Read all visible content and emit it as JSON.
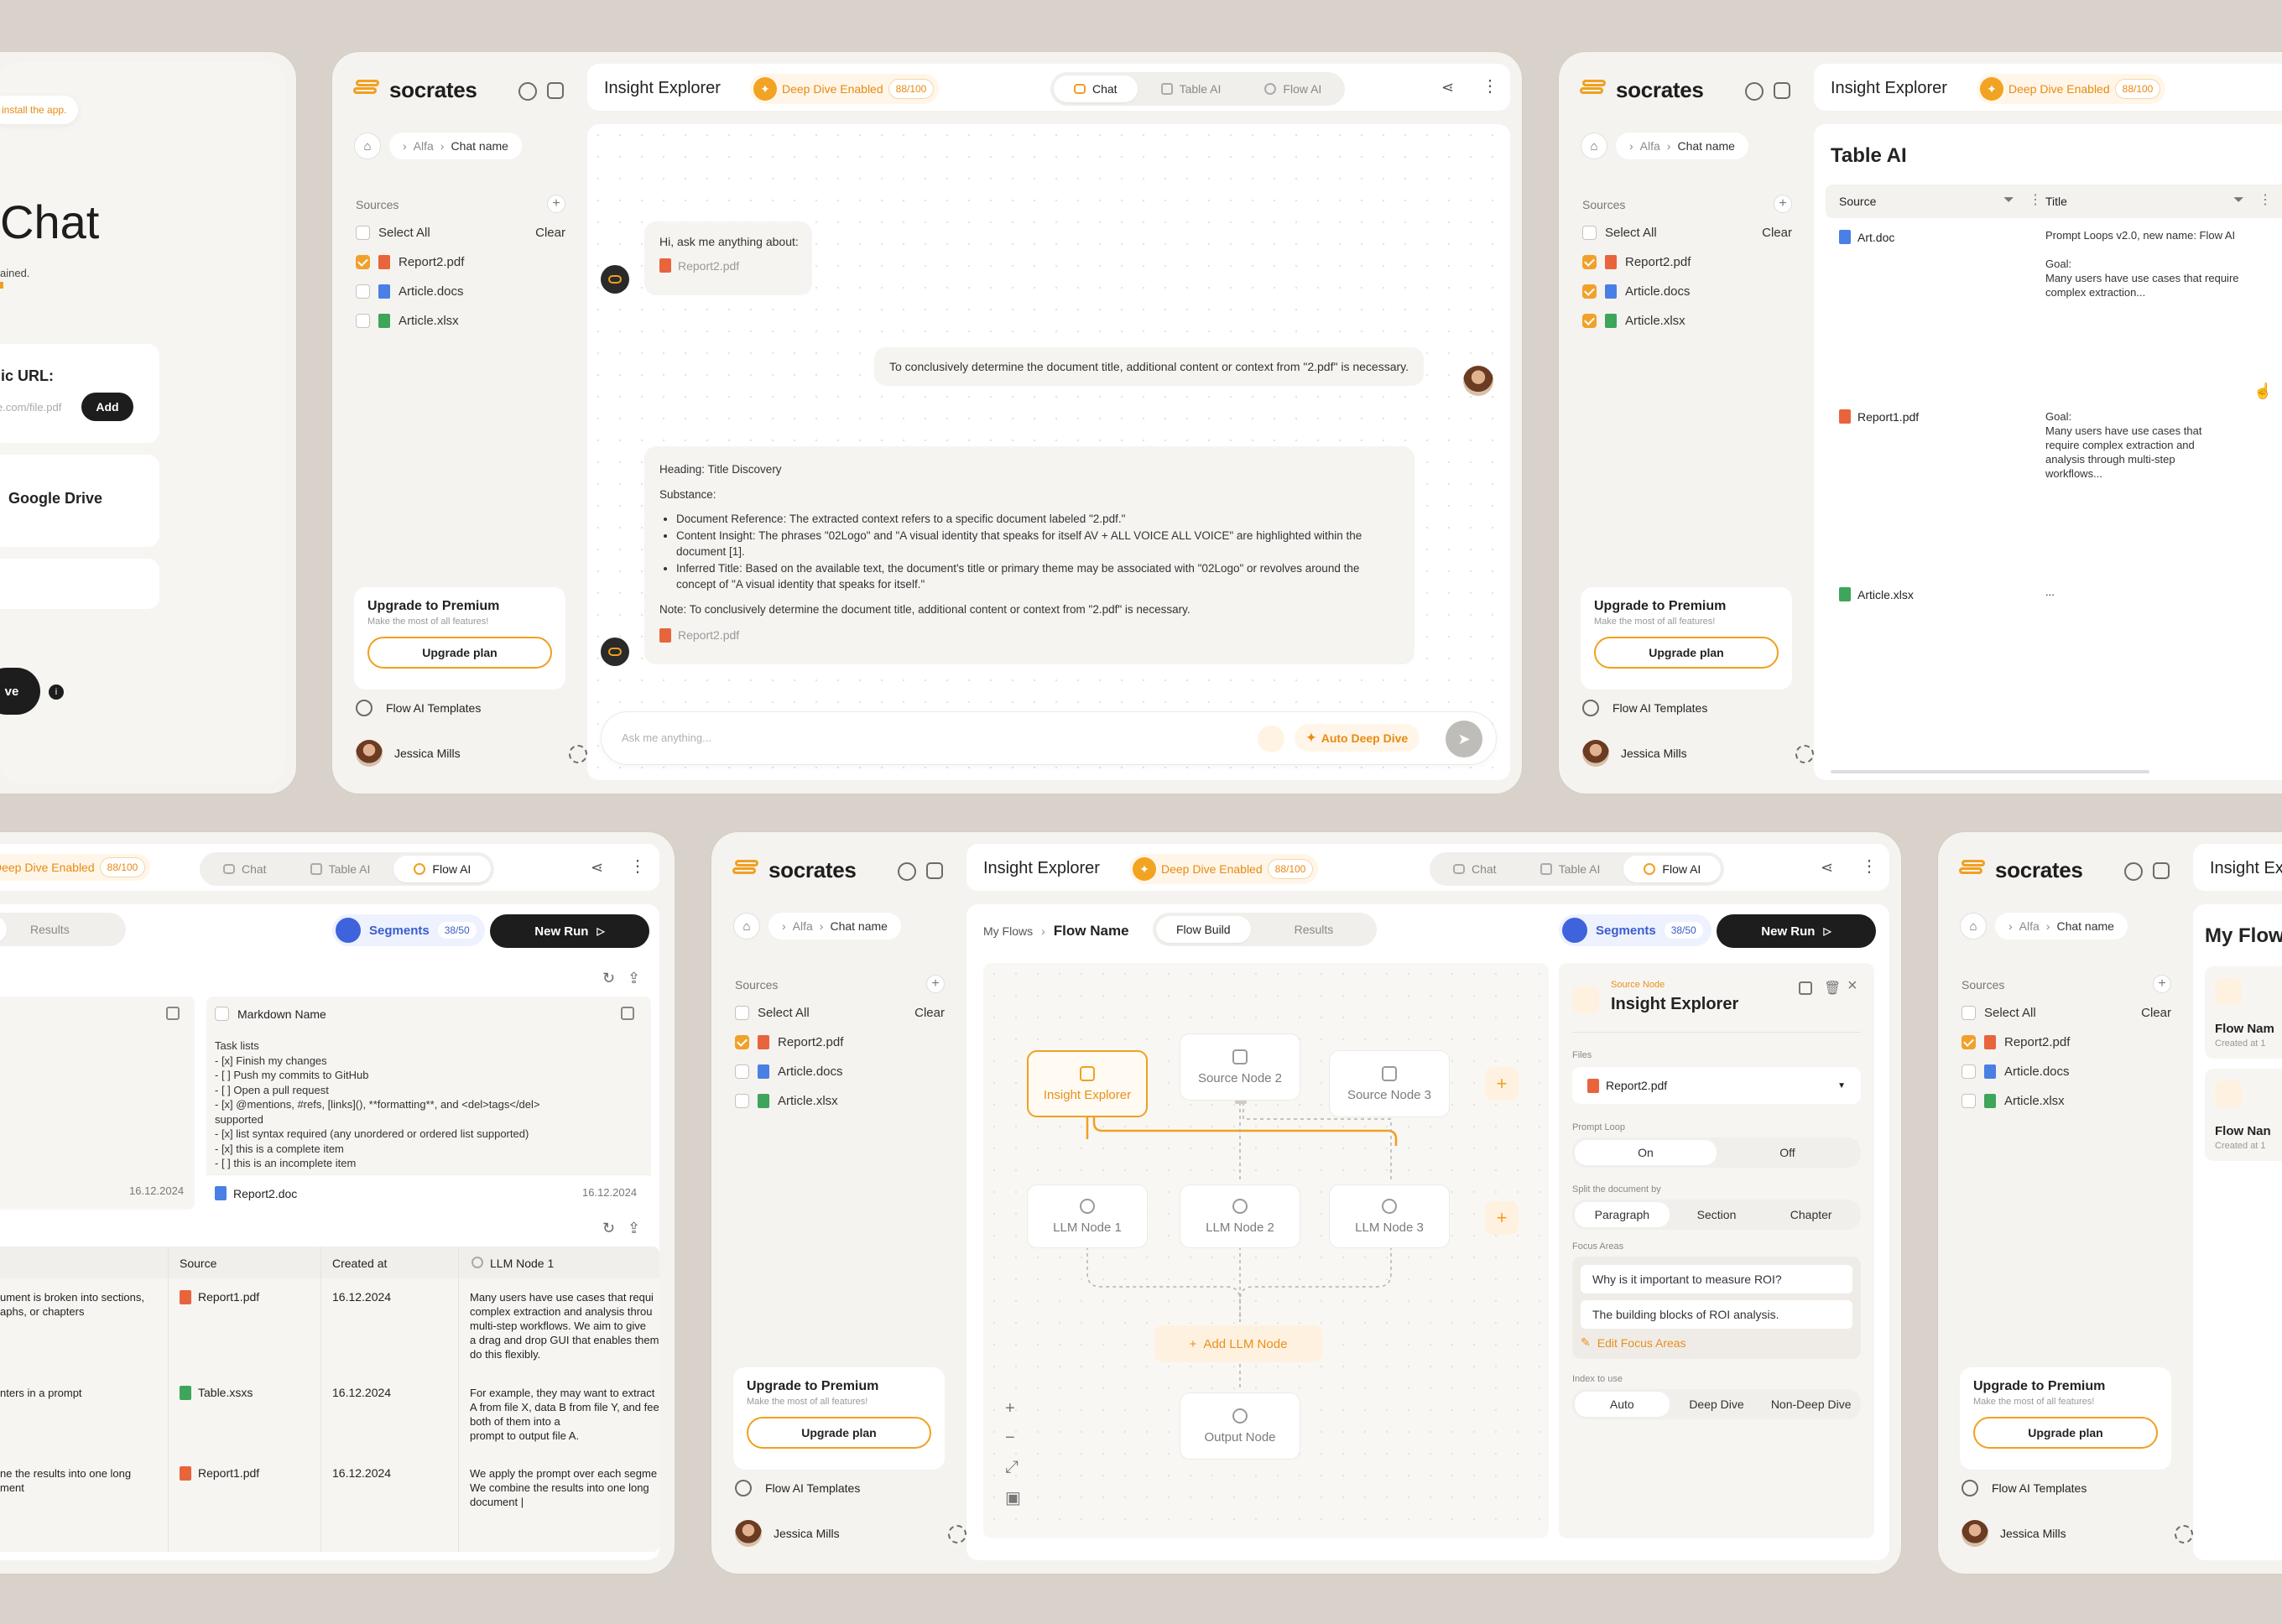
{
  "brand": "socrates",
  "app_title": "Insight Explorer",
  "deep_dive": {
    "label": "Deep Dive Enabled",
    "count": "88/100"
  },
  "tabs": {
    "chat": "Chat",
    "table": "Table AI",
    "flow": "Flow AI"
  },
  "breadcrumb": {
    "parent": "Alfa",
    "current": "Chat name"
  },
  "sources": {
    "title": "Sources",
    "select_all": "Select All",
    "clear": "Clear",
    "files": [
      "Report2.pdf",
      "Article.docs",
      "Article.xlsx"
    ]
  },
  "upgrade": {
    "title": "Upgrade to Premium",
    "subtitle": "Make the most of all features!",
    "button": "Upgrade plan"
  },
  "sidebar_footer": {
    "templates": "Flow AI Templates",
    "user": "Jessica Mills"
  },
  "left_card": {
    "toast": "install the app.",
    "title": "Chat",
    "line1": "ained.",
    "url_label": "lic URL:",
    "url_placeholder": "e.com/file.pdf",
    "add": "Add",
    "drive": "Google Drive",
    "save": "ve"
  },
  "chat": {
    "greeting": "Hi, ask me anything about:",
    "greeting_file": "Report2.pdf",
    "user_msg": "To conclusively determine the document title, additional content or context from \"2.pdf\" is necessary.",
    "heading": "Heading: Title Discovery",
    "substance": "Substance:",
    "bullets": [
      "Document Reference: The extracted context refers to a specific document labeled \"2.pdf.\"",
      "Content Insight: The phrases \"02Logo\" and \"A visual identity that speaks for itself AV + ALL VOICE ALL VOICE\" are highlighted within the document [1].",
      "Inferred Title: Based on the available text, the document's title or primary theme may be associated with \"02Logo\" or revolves around the concept of \"A visual identity that speaks for itself.\""
    ],
    "note": "Note: To conclusively determine the document title, additional content or context from \"2.pdf\" is necessary.",
    "answer_file": "Report2.pdf",
    "input_placeholder": "Ask me anything...",
    "auto_deep": "Auto Deep Dive"
  },
  "table_ai": {
    "title": "Table AI",
    "col_source": "Source",
    "col_title": "Title",
    "rows": [
      {
        "source": "Art.doc",
        "text": "Prompt Loops v2.0, new name: Flow AI\n\nGoal:\nMany users have use cases that require complex extraction..."
      },
      {
        "source": "Report1.pdf",
        "text": "Goal:\nMany users have use cases that require complex extraction and analysis through multi-step workflows..."
      },
      {
        "source": "Article.xlsx",
        "text": "..."
      }
    ]
  },
  "flow_results": {
    "tabs": [
      "ild",
      "Results"
    ],
    "segments": "Segments",
    "segments_count": "38/50",
    "new_run": "New Run",
    "col_markdown": "Markdown Name",
    "markdown_lines": [
      "Task lists",
      "- [x] Finish my changes",
      "- [ ] Push my commits to GitHub",
      "- [ ] Open a pull request",
      "- [x] @mentions, #refs, [links](), **formatting**, and <del>tags</del>",
      "supported",
      "- [x] list syntax required (any unordered or ordered list supported)",
      "- [x] this is a complete item",
      "- [ ] this is an incomplete item"
    ],
    "date1": "16.12.2024",
    "date2": "16.12.2024",
    "doc_file": "Report2.doc",
    "table_headers": [
      "Source",
      "Created at",
      "LLM Node 1"
    ],
    "table_rows": [
      {
        "c0": "ument is broken into sections,\naphs, or chapters",
        "source": "Report1.pdf",
        "date": "16.12.2024",
        "llm": "Many users have use cases that requi\ncomplex extraction and analysis throu\nmulti-step workflows. We aim to give\na drag and drop GUI that enables them\ndo this flexibly."
      },
      {
        "c0": "nters in a prompt",
        "source": "Table.xsxs",
        "date": "16.12.2024",
        "llm": "For example, they may want to extract\nA from file X, data B from file Y, and fee\nboth of them into a\nprompt to output file A."
      },
      {
        "c0": "ne the results into one long\nment",
        "source": "Report1.pdf",
        "date": "16.12.2024",
        "llm": "We apply the prompt over each segme\nWe combine the results into one long\ndocument |"
      }
    ]
  },
  "flow_build": {
    "crumb_parent": "My Flows",
    "crumb_current": "Flow Name",
    "tabs": [
      "Flow Build",
      "Results"
    ],
    "nodes": {
      "src1": "Insight Explorer",
      "src2": "Source Node 2",
      "src3": "Source Node 3",
      "llm1": "LLM Node 1",
      "llm2": "LLM Node 2",
      "llm3": "LLM Node 3",
      "add": "Add LLM Node",
      "out": "Output Node"
    },
    "panel": {
      "kicker": "Source Node",
      "title": "Insight Explorer",
      "files_label": "Files",
      "file": "Report2.pdf",
      "loop_label": "Prompt Loop",
      "loop": [
        "On",
        "Off"
      ],
      "split_label": "Split the document by",
      "split": [
        "Paragraph",
        "Section",
        "Chapter"
      ],
      "focus_label": "Focus Areas",
      "focus": [
        "Why is it important to measure ROI?",
        "The building blocks of ROI analysis."
      ],
      "edit_focus": "Edit Focus Areas",
      "index_label": "Index to use",
      "index": [
        "Auto",
        "Deep Dive",
        "Non-Deep Dive"
      ]
    }
  },
  "right_card": {
    "title_partial": "Insight Ex",
    "heading": "My Flow",
    "items": [
      {
        "name": "Flow Nam",
        "date": "Created at 1"
      },
      {
        "name": "Flow Nan",
        "date": "Created at 1"
      }
    ]
  },
  "colors": {
    "accent": "#f0a020",
    "bg": "#d9d2ca",
    "card": "#f5f3ef",
    "blue": "#3e63dd"
  }
}
